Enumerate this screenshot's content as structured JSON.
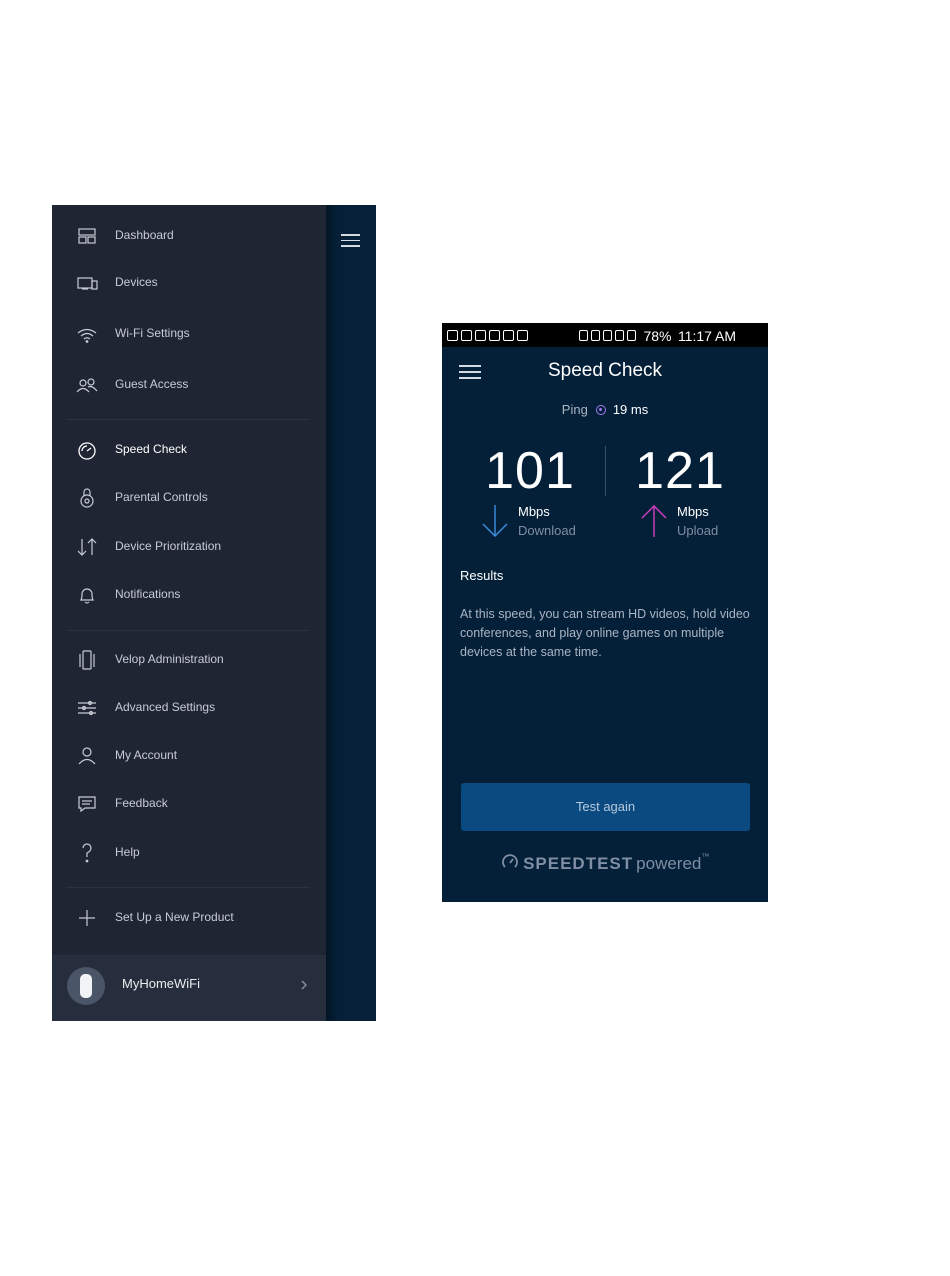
{
  "menu": {
    "items": [
      {
        "label": "Dashboard",
        "icon": "dashboard-icon"
      },
      {
        "label": "Devices",
        "icon": "devices-icon"
      },
      {
        "label": "Wi-Fi Settings",
        "icon": "wifi-icon"
      },
      {
        "label": "Guest Access",
        "icon": "guest-access-icon"
      },
      {
        "label": "Speed Check",
        "icon": "speedometer-icon",
        "active": true
      },
      {
        "label": "Parental Controls",
        "icon": "parental-lock-icon"
      },
      {
        "label": "Device Prioritization",
        "icon": "priority-arrows-icon"
      },
      {
        "label": "Notifications",
        "icon": "bell-icon"
      },
      {
        "label": "Velop Administration",
        "icon": "velop-node-icon"
      },
      {
        "label": "Advanced Settings",
        "icon": "sliders-icon"
      },
      {
        "label": "My Account",
        "icon": "user-icon"
      },
      {
        "label": "Feedback",
        "icon": "feedback-icon"
      },
      {
        "label": "Help",
        "icon": "help-icon"
      },
      {
        "label": "Set Up a New Product",
        "icon": "plus-icon"
      }
    ],
    "network": {
      "name": "MyHomeWiFi"
    }
  },
  "speed": {
    "status_bar": {
      "battery": "78%",
      "time": "11:17 AM"
    },
    "title": "Speed Check",
    "ping_label": "Ping",
    "ping_value": "19 ms",
    "download": {
      "value": "101",
      "unit": "Mbps",
      "label": "Download"
    },
    "upload": {
      "value": "121",
      "unit": "Mbps",
      "label": "Upload"
    },
    "results_title": "Results",
    "results_text": "At this speed, you can stream HD videos, hold video conferences, and play online games on multiple devices at the same time.",
    "button_label": "Test again",
    "brand": {
      "name": "SPEEDTEST",
      "powered": "powered",
      "tm": "™"
    }
  },
  "colors": {
    "drawer_bg": "#1f2533",
    "app_bg": "#042039",
    "button_bg": "#0a4a80",
    "download_arrow": "#3d8fe0",
    "upload_arrow": "#d23fc0",
    "ping_dot": "#a37af0"
  }
}
